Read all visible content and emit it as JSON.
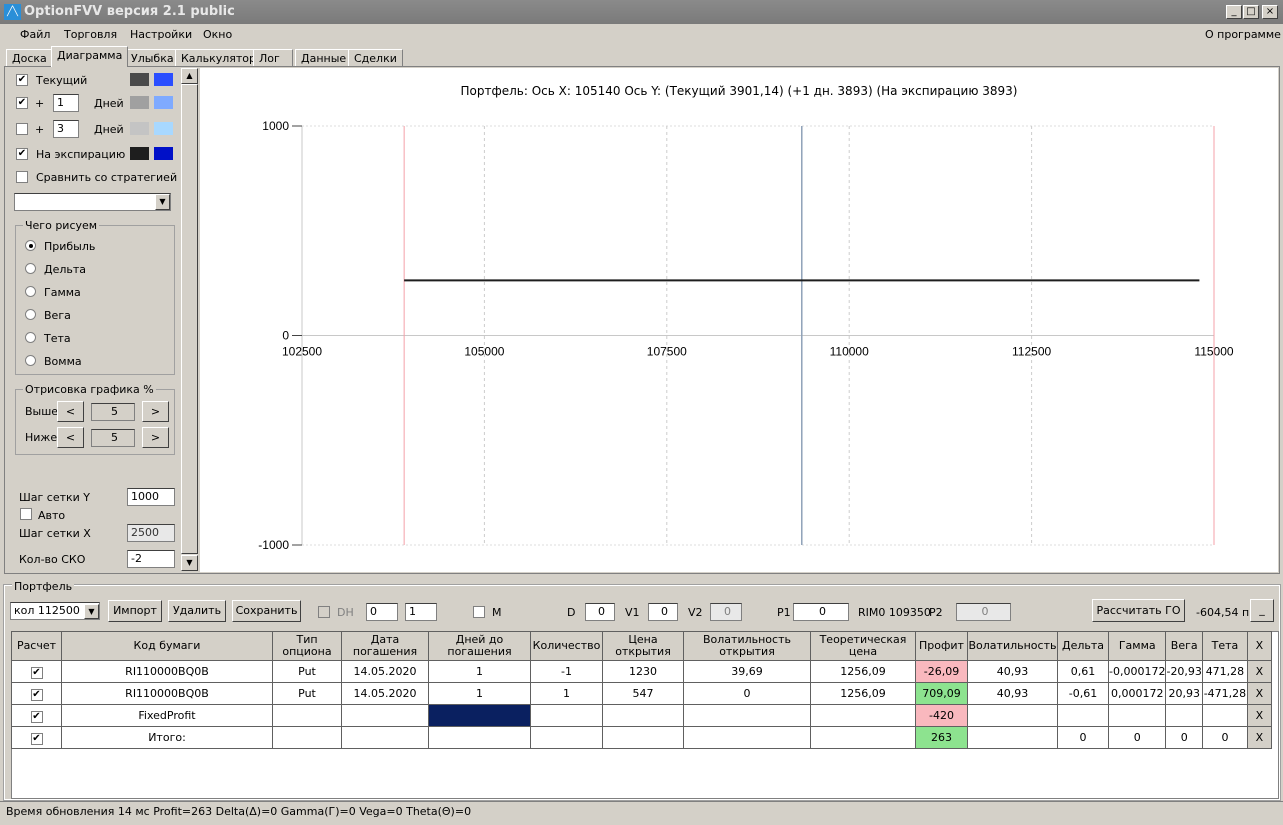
{
  "window": {
    "title": "OptionFVV версия 2.1 public",
    "logo": "FVV"
  },
  "menu": {
    "items": [
      "Файл",
      "Торговля",
      "Настройки",
      "Окно"
    ],
    "about": "О программе"
  },
  "tabs": [
    "Доска",
    "Диаграмма",
    "Улыбка",
    "Калькулятор",
    "Лог",
    "Данные",
    "Сделки"
  ],
  "left": {
    "current": "Текущий",
    "plus": "+",
    "days": "Дней",
    "days1": "1",
    "days2": "3",
    "expiry": "На экспирацию",
    "compare": "Сравнить со стратегией",
    "colors": {
      "current": [
        "#4a4a4a",
        "#2a4eff"
      ],
      "d1": [
        "#a0a0a0",
        "#7faaff"
      ],
      "d2": [
        "#c4c4c4",
        "#a8d8ff"
      ],
      "exp": [
        "#1e1e1e",
        "#0010c8"
      ]
    },
    "what_title": "Чего рисуем",
    "what": [
      "Прибыль",
      "Дельта",
      "Гамма",
      "Вега",
      "Тета",
      "Вомма"
    ],
    "draw_title": "Отрисовка графика %",
    "above": "Выше",
    "below": "Ниже",
    "above_val": "5",
    "below_val": "5",
    "grid_y_label": "Шаг сетки Y",
    "grid_y": "1000",
    "auto": "Авто",
    "grid_x_label": "Шаг сетки X",
    "grid_x": "2500",
    "sko_label": "Кол-во СКО",
    "sko": "-2"
  },
  "chart_data": {
    "type": "line",
    "title": "Портфель: Ось X: 105140 Ось Y:  (Текущий 3901,14)  (+1 дн. 3893)  (На экспирацию 3893)",
    "xlim": [
      102500,
      115000
    ],
    "ylim": [
      -1000,
      1000
    ],
    "xticks": [
      "102500",
      "105000",
      "107500",
      "110000",
      "112500",
      "115000"
    ],
    "yticks": [
      "1000",
      "0",
      "-1000"
    ],
    "series": [
      {
        "name": "На экспирацию",
        "x": [
          103900,
          114800
        ],
        "y": [
          263,
          263
        ],
        "color": "#1e1e1e"
      }
    ],
    "markers": {
      "red_lines": [
        103900,
        115000
      ],
      "current_price": 109350
    }
  },
  "portfolio": {
    "title": "Портфель",
    "selector": "кол 112500",
    "import": "Импорт",
    "delete": "Удалить",
    "save": "Сохранить",
    "dh": "DH",
    "spin1": "0",
    "spin2": "1",
    "m": "M",
    "d_label": "D",
    "d": "0",
    "v1_label": "V1",
    "v1": "0",
    "v2_label": "V2",
    "v2": "0",
    "p1_label": "P1",
    "p1": "0",
    "instrument": "RIM0 109350",
    "p2_label": "P2",
    "p2": "0",
    "calc": "Рассчитать ГО",
    "go": "-604,54 п.",
    "min": "_",
    "headers": [
      "Расчет",
      "Код бумаги",
      "Тип опциона",
      "Дата погашения",
      "Дней до погашения",
      "Количество",
      "Цена открытия",
      "Волатильность открытия",
      "Теоретическая цена",
      "Профит",
      "Волатильность",
      "Дельта",
      "Гамма",
      "Вега",
      "Тета",
      "X"
    ],
    "rows": [
      [
        "✔",
        "RI110000BQ0B",
        "Put",
        "14.05.2020",
        "1",
        "-1",
        "1230",
        "39,69",
        "1256,09",
        "-26,09",
        "40,93",
        "0,61",
        "-0,000172",
        "-20,93",
        "471,28",
        "X"
      ],
      [
        "✔",
        "RI110000BQ0B",
        "Put",
        "14.05.2020",
        "1",
        "1",
        "547",
        "0",
        "1256,09",
        "709,09",
        "40,93",
        "-0,61",
        "0,000172",
        "20,93",
        "-471,28",
        "X"
      ],
      [
        "✔",
        "FixedProfit",
        "",
        "",
        "",
        "",
        "",
        "",
        "",
        "-420",
        "",
        "",
        "",
        "",
        "",
        "X"
      ],
      [
        "✔",
        "Итого:",
        "",
        "",
        "",
        "",
        "",
        "",
        "",
        "263",
        "",
        "0",
        "0",
        "0",
        "0",
        "X"
      ]
    ]
  },
  "status": "Время обновления 14 мс  Profit=263 Delta(Δ)=0 Gamma(Г)=0 Vega=0 Theta(Θ)=0"
}
